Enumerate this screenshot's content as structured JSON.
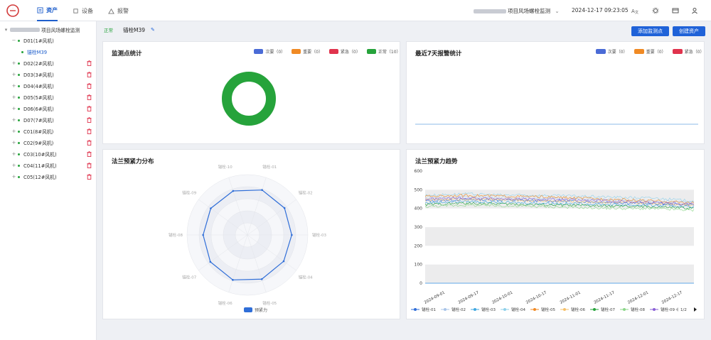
{
  "topbar": {
    "nav": [
      {
        "label": "资产",
        "icon": "asset-icon"
      },
      {
        "label": "设备",
        "icon": "device-icon"
      },
      {
        "label": "报警",
        "icon": "alarm-icon"
      }
    ],
    "project": "项目风场螺栓监测",
    "datetime": "2024-12-17 09:23:05"
  },
  "sidebar": {
    "root": "项目风场螺栓监测",
    "items": [
      {
        "label": "D01(1#风机)",
        "expanded": true
      },
      {
        "label": "锚栓M39",
        "child": true,
        "selected": true
      },
      {
        "label": "D02(2#风机)"
      },
      {
        "label": "D03(3#风机)"
      },
      {
        "label": "D04(4#风机)"
      },
      {
        "label": "D05(5#风机)"
      },
      {
        "label": "D06(6#风机)"
      },
      {
        "label": "D07(7#风机)"
      },
      {
        "label": "C01(8#风机)"
      },
      {
        "label": "C02(9#风机)"
      },
      {
        "label": "C03(10#风机)"
      },
      {
        "label": "C04(11#风机)"
      },
      {
        "label": "C05(12#风机)"
      }
    ]
  },
  "header": {
    "status": "正常",
    "asset": "锚栓M39"
  },
  "buttons": {
    "add_point": "添加监测点",
    "create_asset": "创建资产"
  },
  "colors": {
    "secondary": "#4a6bd6",
    "important": "#f08a24",
    "urgent": "#e0334d",
    "normal": "#26a33b",
    "accent": "#1f62d8"
  },
  "stats_card": {
    "title": "监测点统计",
    "legend": [
      {
        "label": "次要（0）",
        "color": "#4a6bd6"
      },
      {
        "label": "重要（0）",
        "color": "#f08a24"
      },
      {
        "label": "紧急（0）",
        "color": "#e0334d"
      },
      {
        "label": "正常（10）",
        "color": "#26a33b"
      }
    ]
  },
  "alarm_card": {
    "title": "最近7天报警统计",
    "legend": [
      {
        "label": "次要（0）",
        "color": "#4a6bd6"
      },
      {
        "label": "重要（0）",
        "color": "#f08a24"
      },
      {
        "label": "紧急（0）",
        "color": "#e0334d"
      }
    ]
  },
  "radar_card": {
    "title": "法兰预紧力分布",
    "legend": "预紧力"
  },
  "trend_card": {
    "title": "法兰预紧力趋势",
    "page": "1/2"
  },
  "chart_data": [
    {
      "type": "pie",
      "title": "监测点统计",
      "categories": [
        "次要",
        "重要",
        "紧急",
        "正常"
      ],
      "values": [
        0,
        0,
        0,
        10
      ]
    },
    {
      "type": "line",
      "title": "最近7天报警统计",
      "series": [
        {
          "name": "次要",
          "values": [
            0,
            0,
            0,
            0,
            0,
            0,
            0
          ]
        },
        {
          "name": "重要",
          "values": [
            0,
            0,
            0,
            0,
            0,
            0,
            0
          ]
        },
        {
          "name": "紧急",
          "values": [
            0,
            0,
            0,
            0,
            0,
            0,
            0
          ]
        }
      ]
    },
    {
      "type": "radar",
      "title": "法兰预紧力分布",
      "categories": [
        "锚栓-01",
        "锚栓-02",
        "锚栓-03",
        "锚栓-04",
        "锚栓-05",
        "锚栓-06",
        "锚栓-07",
        "锚栓-08",
        "锚栓-09",
        "锚栓-10"
      ],
      "series": [
        {
          "name": "预紧力",
          "values": [
            470,
            455,
            440,
            445,
            462,
            470,
            455,
            440,
            450,
            460
          ]
        }
      ],
      "rmax": 600
    },
    {
      "type": "line",
      "title": "法兰预紧力趋势",
      "x": [
        "2024-09-01",
        "2024-09-17",
        "2024-10-01",
        "2024-10-17",
        "2024-11-01",
        "2024-11-17",
        "2024-12-01",
        "2024-12-17"
      ],
      "ylim": [
        0,
        600
      ],
      "yticks": [
        0,
        100,
        200,
        300,
        400,
        500,
        600
      ],
      "series": [
        {
          "name": "锚栓-01",
          "color": "#2f6ed8",
          "values": [
            440,
            448,
            445,
            440,
            438,
            432,
            425,
            420
          ]
        },
        {
          "name": "锚栓-02",
          "color": "#a8c4e8",
          "values": [
            455,
            462,
            458,
            455,
            450,
            445,
            440,
            430
          ]
        },
        {
          "name": "锚栓-03",
          "color": "#3fa7e0",
          "values": [
            430,
            438,
            432,
            428,
            425,
            420,
            416,
            410
          ]
        },
        {
          "name": "锚栓-04",
          "color": "#8fd0ea",
          "values": [
            470,
            478,
            472,
            470,
            466,
            460,
            455,
            440
          ]
        },
        {
          "name": "锚栓-05",
          "color": "#f08a24",
          "values": [
            465,
            470,
            466,
            462,
            455,
            448,
            440,
            430
          ]
        },
        {
          "name": "锚栓-06",
          "color": "#f5c06a",
          "values": [
            445,
            450,
            446,
            442,
            438,
            432,
            428,
            420
          ]
        },
        {
          "name": "锚栓-07",
          "color": "#26a33b",
          "values": [
            420,
            428,
            424,
            420,
            416,
            412,
            408,
            400
          ]
        },
        {
          "name": "锚栓-08",
          "color": "#8cd68a",
          "values": [
            410,
            418,
            414,
            410,
            405,
            400,
            398,
            390
          ]
        },
        {
          "name": "锚栓-09",
          "color": "#8a5fd6",
          "values": [
            450,
            456,
            452,
            448,
            444,
            438,
            432,
            425
          ]
        }
      ]
    }
  ]
}
